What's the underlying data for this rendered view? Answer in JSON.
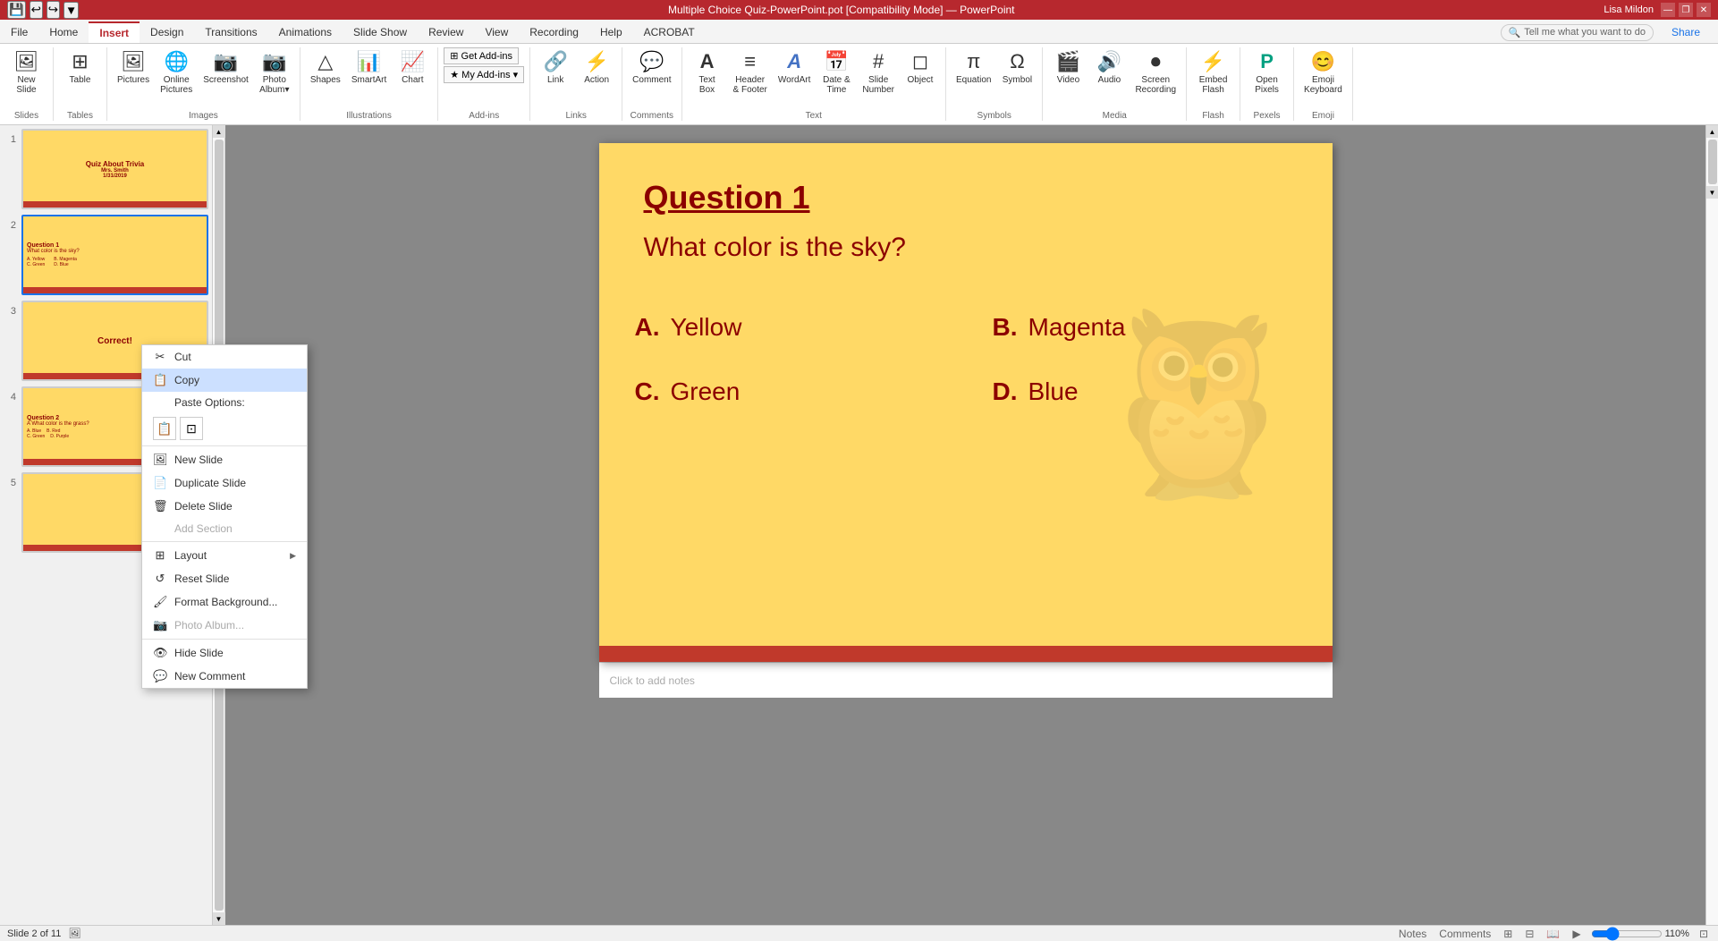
{
  "titlebar": {
    "title": "Multiple Choice Quiz-PowerPoint.pot [Compatibility Mode] — PowerPoint",
    "user": "Lisa Mildon",
    "minimize": "—",
    "restore": "❐",
    "close": "✕"
  },
  "quickaccess": {
    "save_label": "💾",
    "undo_label": "↩",
    "redo_label": "↪",
    "customize_label": "▼"
  },
  "ribbon": {
    "tabs": [
      "File",
      "Home",
      "Insert",
      "Design",
      "Transitions",
      "Animations",
      "Slide Show",
      "Review",
      "View",
      "Recording",
      "Help",
      "ACROBAT"
    ],
    "active_tab": "Insert",
    "search_placeholder": "Tell me what you want to do",
    "share_label": "Share",
    "groups": [
      {
        "name": "Slides",
        "items": [
          {
            "label": "New\nSlide",
            "icon": "🖼"
          },
          {
            "label": "Table",
            "icon": "⊞"
          },
          {
            "label": "Pictures",
            "icon": "🖼"
          },
          {
            "label": "Online\nPictures",
            "icon": "🌐"
          },
          {
            "label": "Screenshot",
            "icon": "📷"
          },
          {
            "label": "Photo\nAlbum",
            "icon": "📷"
          }
        ]
      },
      {
        "name": "Tables",
        "items": []
      },
      {
        "name": "Images",
        "items": []
      },
      {
        "name": "Illustrations",
        "items": [
          {
            "label": "Shapes",
            "icon": "△"
          },
          {
            "label": "SmartArt",
            "icon": "📊"
          },
          {
            "label": "Chart",
            "icon": "📈"
          }
        ]
      },
      {
        "name": "Add-ins",
        "items": [
          {
            "label": "Get Add-ins",
            "icon": "➕"
          },
          {
            "label": "My Add-ins",
            "icon": "★"
          }
        ]
      },
      {
        "name": "Links",
        "items": [
          {
            "label": "Link",
            "icon": "🔗"
          },
          {
            "label": "Action",
            "icon": "⚡"
          }
        ]
      },
      {
        "name": "Comments",
        "items": [
          {
            "label": "Comment",
            "icon": "💬"
          }
        ]
      },
      {
        "name": "Text",
        "items": [
          {
            "label": "Text\nBox",
            "icon": "A"
          },
          {
            "label": "Header\n& Footer",
            "icon": "≡"
          },
          {
            "label": "WordArt",
            "icon": "A"
          },
          {
            "label": "Date &\nTime",
            "icon": "📅"
          },
          {
            "label": "Slide\nNumber",
            "icon": "#"
          },
          {
            "label": "Object",
            "icon": "◻"
          }
        ]
      },
      {
        "name": "Symbols",
        "items": [
          {
            "label": "Equation",
            "icon": "π"
          },
          {
            "label": "Symbol",
            "icon": "Ω"
          }
        ]
      },
      {
        "name": "Media",
        "items": [
          {
            "label": "Video",
            "icon": "🎬"
          },
          {
            "label": "Audio",
            "icon": "🔊"
          },
          {
            "label": "Screen\nRecording",
            "icon": "⏺"
          }
        ]
      },
      {
        "name": "Flash",
        "items": [
          {
            "label": "Embed\nFlash",
            "icon": "⚡"
          }
        ]
      },
      {
        "name": "Pexels",
        "items": [
          {
            "label": "Open\nPixels",
            "icon": "P"
          }
        ]
      },
      {
        "name": "Emoji",
        "items": [
          {
            "label": "Emoji\nKeyboard",
            "icon": "😊"
          }
        ]
      }
    ]
  },
  "slides": [
    {
      "num": "1",
      "content": "Quiz About Trivia\nMrs. Smith\n1/31/2019",
      "type": "title",
      "active": false
    },
    {
      "num": "2",
      "content": "Question 1\nWhat color is the sky?\nA. Yellow  B. Magenta\nC. Green   D. Blue",
      "type": "question",
      "active": true
    },
    {
      "num": "3",
      "content": "Correct!",
      "type": "correct",
      "active": false
    },
    {
      "num": "4",
      "content": "Question 2\nA What color is the grass?\nA. Blue  B. Red\nC. Green  D. Purple",
      "type": "question",
      "active": false
    },
    {
      "num": "5",
      "content": "",
      "type": "blank",
      "active": false
    }
  ],
  "slide_content": {
    "title": "Question 1",
    "question": "What color is the sky?",
    "answers": [
      {
        "label": "A.",
        "text": "Yellow"
      },
      {
        "label": "B.",
        "text": "Magenta"
      },
      {
        "label": "C.",
        "text": "Green"
      },
      {
        "label": "D.",
        "text": "Blue"
      }
    ]
  },
  "context_menu": {
    "items": [
      {
        "id": "cut",
        "label": "Cut",
        "icon": "✂",
        "enabled": true,
        "shortcut": ""
      },
      {
        "id": "copy",
        "label": "Copy",
        "icon": "📋",
        "enabled": true,
        "active": true,
        "shortcut": ""
      },
      {
        "id": "paste-options-label",
        "label": "Paste Options:",
        "type": "paste-header",
        "enabled": true
      },
      {
        "id": "paste-options",
        "type": "paste-icons"
      },
      {
        "id": "new-slide",
        "label": "New Slide",
        "icon": "🖼",
        "enabled": true
      },
      {
        "id": "duplicate-slide",
        "label": "Duplicate Slide",
        "icon": "📄",
        "enabled": true
      },
      {
        "id": "delete-slide",
        "label": "Delete Slide",
        "icon": "🗑",
        "enabled": true
      },
      {
        "id": "add-section",
        "label": "Add Section",
        "icon": "",
        "enabled": false
      },
      {
        "id": "layout",
        "label": "Layout",
        "icon": "⊞",
        "enabled": true,
        "submenu": true
      },
      {
        "id": "reset-slide",
        "label": "Reset Slide",
        "icon": "↺",
        "enabled": true
      },
      {
        "id": "format-background",
        "label": "Format Background...",
        "icon": "🖌",
        "enabled": true
      },
      {
        "id": "photo-album",
        "label": "Photo Album...",
        "icon": "📷",
        "enabled": false
      },
      {
        "id": "hide-slide",
        "label": "Hide Slide",
        "icon": "👁",
        "enabled": true
      },
      {
        "id": "new-comment",
        "label": "New Comment",
        "icon": "💬",
        "enabled": true
      }
    ]
  },
  "notes": {
    "placeholder": "Click to add notes"
  },
  "status": {
    "slide_info": "Slide 2 of 11",
    "notes_btn": "Notes",
    "comments_btn": "Comments",
    "normal_view": "⊞",
    "slide_sorter": "⊟",
    "reading_view": "📖",
    "slideshow": "▶",
    "zoom": "110%",
    "fit_btn": "⊡"
  }
}
